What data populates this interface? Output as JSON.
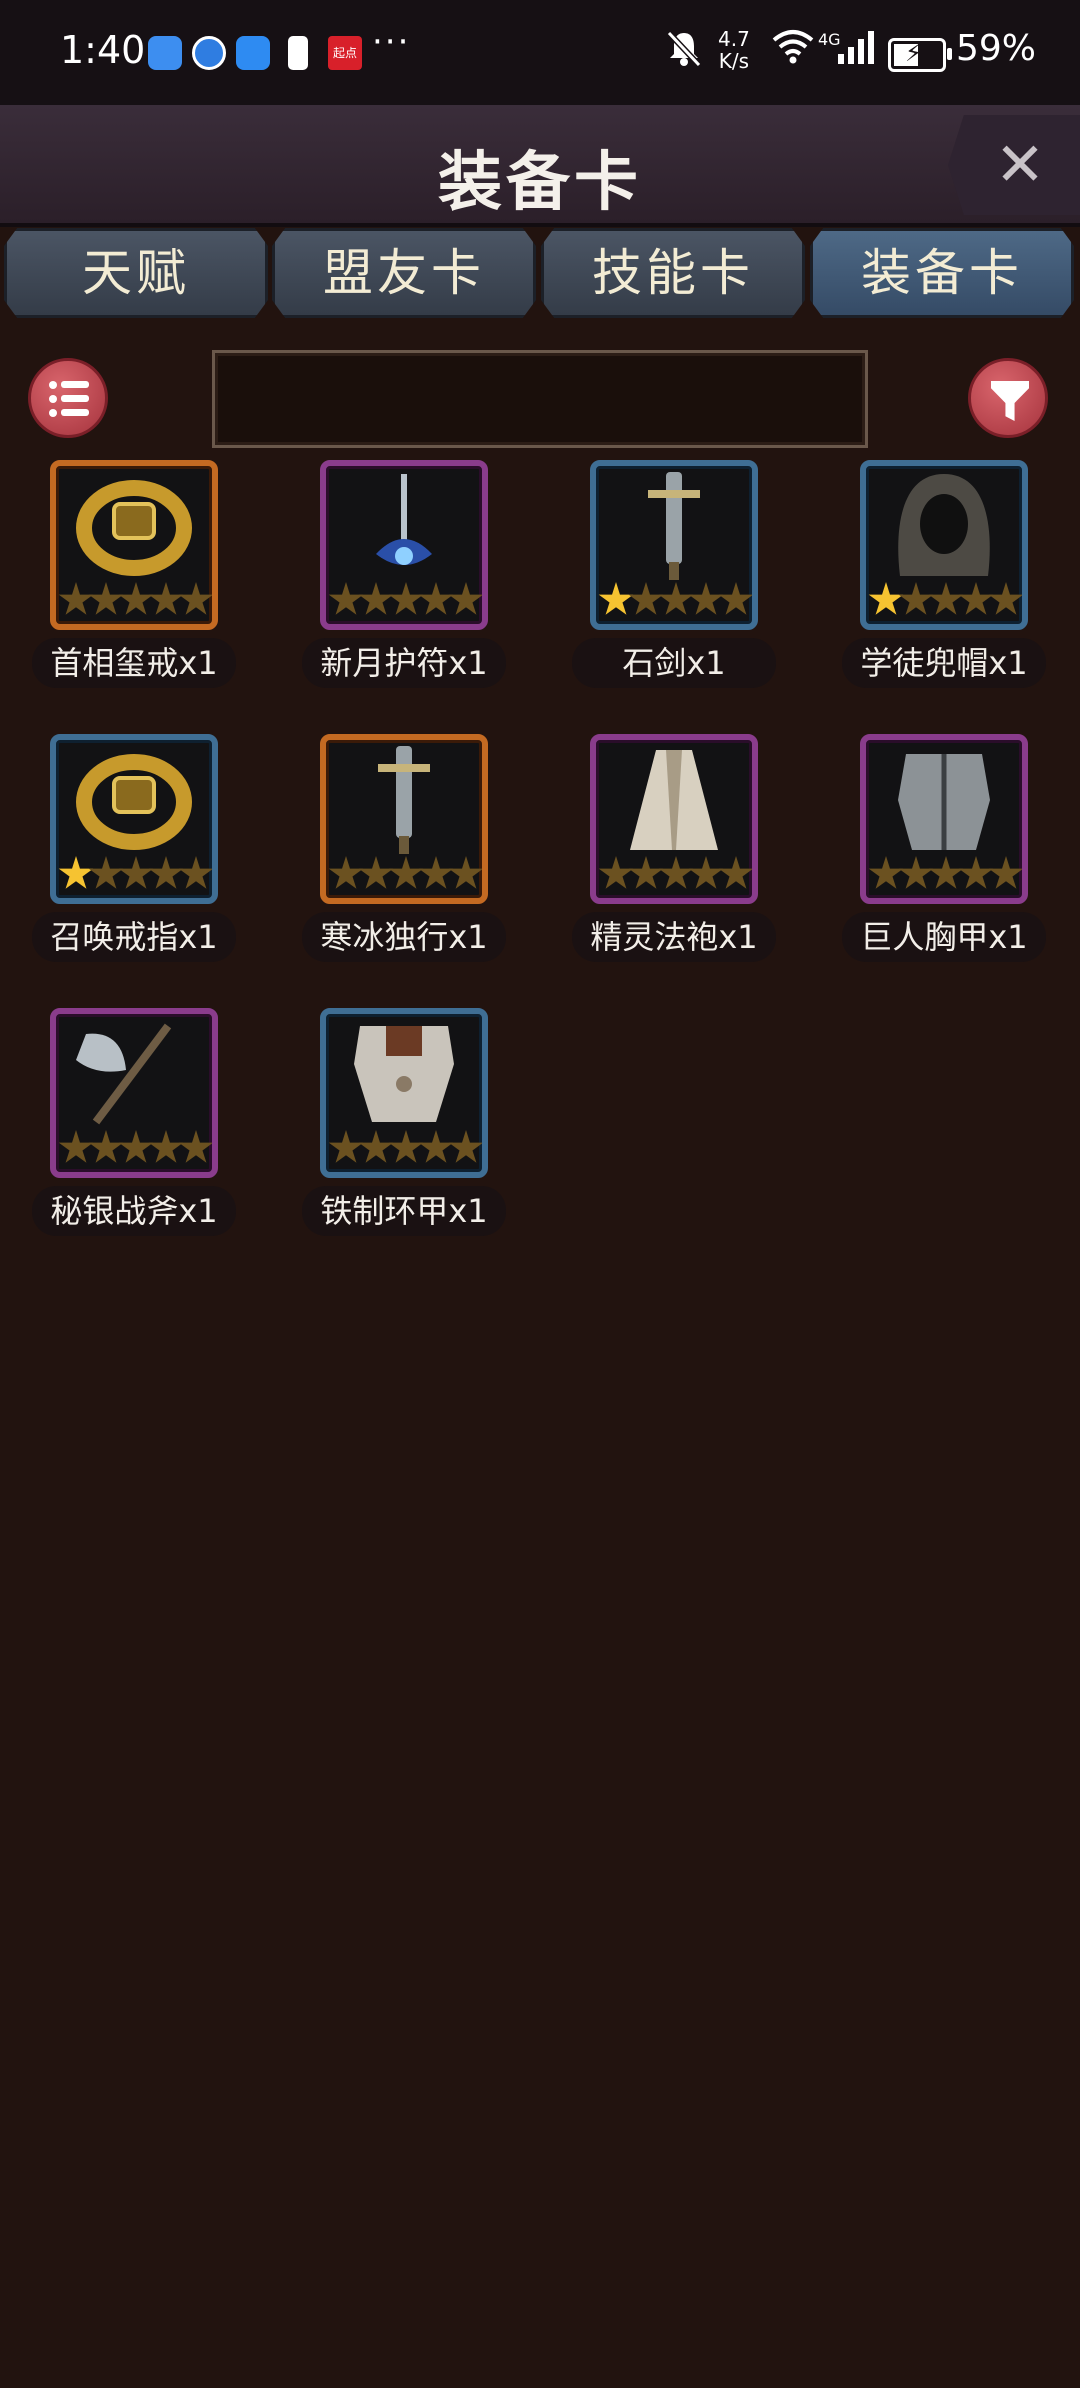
{
  "status_bar": {
    "time": "1:40",
    "net_speed_value": "4.7",
    "net_speed_unit": "K/s",
    "network": "4G",
    "battery": "59%",
    "battery_level": 0.59,
    "more": "···",
    "app_badge": "起点"
  },
  "header": {
    "title": "装备卡",
    "close": "✕"
  },
  "tabs": [
    {
      "label": "天赋",
      "active": false
    },
    {
      "label": "盟友卡",
      "active": false
    },
    {
      "label": "技能卡",
      "active": false
    },
    {
      "label": "装备卡",
      "active": true
    }
  ],
  "search": {
    "placeholder": ""
  },
  "cards": [
    {
      "label": "首相玺戒x1",
      "frame": "orange",
      "stars": 0,
      "icon": "ring-icon"
    },
    {
      "label": "新月护符x1",
      "frame": "purple",
      "stars": 0,
      "icon": "amulet-icon"
    },
    {
      "label": "石剑x1",
      "frame": "blue",
      "stars": 1,
      "icon": "sword-icon"
    },
    {
      "label": "学徒兜帽x1",
      "frame": "blue",
      "stars": 1,
      "icon": "hood-icon"
    },
    {
      "label": "召唤戒指x1",
      "frame": "blue",
      "stars": 1,
      "icon": "ring-icon"
    },
    {
      "label": "寒冰独行x1",
      "frame": "orange",
      "stars": 0,
      "icon": "sword-icon"
    },
    {
      "label": "精灵法袍x1",
      "frame": "purple",
      "stars": 0,
      "icon": "robe-icon"
    },
    {
      "label": "巨人胸甲x1",
      "frame": "purple",
      "stars": 0,
      "icon": "breastplate-icon"
    },
    {
      "label": "秘银战斧x1",
      "frame": "purple",
      "stars": 0,
      "icon": "axe-icon"
    },
    {
      "label": "铁制环甲x1",
      "frame": "blue",
      "stars": 0,
      "icon": "armor-icon"
    }
  ]
}
